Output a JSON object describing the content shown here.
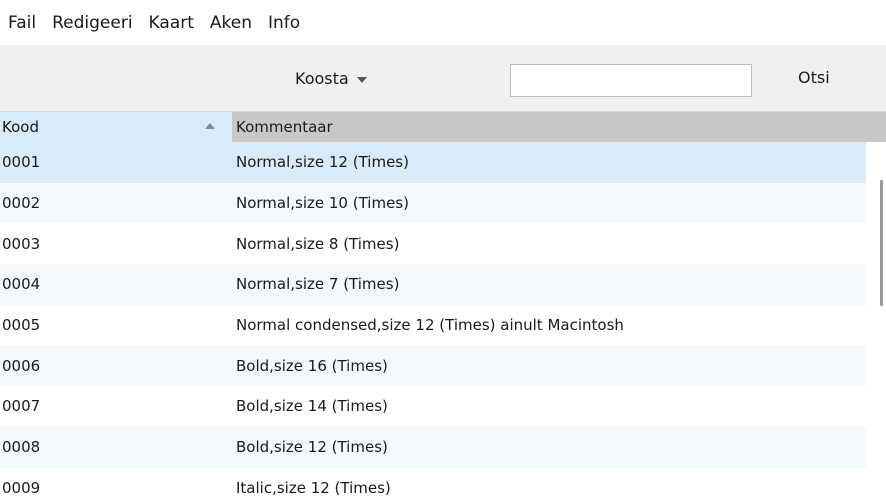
{
  "menu": [
    "Fail",
    "Redigeeri",
    "Kaart",
    "Aken",
    "Info"
  ],
  "toolbar": {
    "compose_label": "Koosta",
    "search_value": "",
    "search_button": "Otsi"
  },
  "table": {
    "columns": [
      "Kood",
      "Kommentaar"
    ],
    "sort": "ascending",
    "selected_row": 0,
    "rows": [
      {
        "code": "0001",
        "comment": "Normal,size 12 (Times)"
      },
      {
        "code": "0002",
        "comment": "Normal,size 10 (Times)"
      },
      {
        "code": "0003",
        "comment": "Normal,size 8 (Times)"
      },
      {
        "code": "0004",
        "comment": "Normal,size 7 (Times)"
      },
      {
        "code": "0005",
        "comment": "Normal condensed,size 12 (Times) ainult Macintosh"
      },
      {
        "code": "0006",
        "comment": "Bold,size 16 (Times)"
      },
      {
        "code": "0007",
        "comment": "Bold,size 14 (Times)"
      },
      {
        "code": "0008",
        "comment": "Bold,size 12 (Times)"
      },
      {
        "code": "0009",
        "comment": "Italic,size 12 (Times)"
      }
    ]
  },
  "colors": {
    "selection": "#d9eaf9",
    "alt_row": "#f3f8fd",
    "header_gray": "#c8c8c8",
    "toolbar_bg": "#f0f0f0"
  },
  "icons": {
    "compose_caret": "chevron-down-icon",
    "sort": "sort-ascending-icon"
  }
}
